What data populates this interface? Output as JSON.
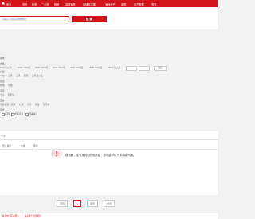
{
  "nav": {
    "logo": "房米",
    "items": [
      "首页",
      "新房",
      "二手房",
      "租房",
      "装修家居",
      "商铺写字楼",
      "海外房产",
      "家居",
      "房产数据",
      "登录"
    ]
  },
  "search": {
    "placeholder": "请输入小区名称或地址",
    "button_label": "搜 索"
  },
  "filters": {
    "region_label": "区域",
    "price_label": "价格",
    "price_options": [
      "1000元以下",
      "1000-1500元",
      "1500-2000元",
      "2000-3000元",
      "3000-4000元",
      "4000-5000元",
      "5000元以上"
    ],
    "confirm_label": "确定",
    "rooms_label": "户型",
    "rooms_options": [
      "一室",
      "二室",
      "三室",
      "四室",
      "五室及以上"
    ],
    "type_label": "类型",
    "type_options": [
      "整租",
      "合租"
    ],
    "source_label": "来源",
    "source_options": [
      "个人",
      "经纪人"
    ],
    "more_label": "更多",
    "more_options": [
      "普通住宅",
      "别墅",
      "公寓",
      "平房",
      "商住",
      "写字楼"
    ],
    "check_label": "筛选",
    "check_options": [
      "有图",
      "视频房源",
      "直播看房"
    ]
  },
  "results": {
    "tab": "个人",
    "sort": [
      "默认排序",
      "价格",
      "面积"
    ],
    "empty_message": "很抱歉，没有找到相符的房源，您可能对以下房源感兴趣。"
  },
  "pager": {
    "prev": "首页",
    "current": "1",
    "next": "尾页",
    "last": "末页"
  },
  "bottom_tabs": [
    "临安热门区域租房",
    "临安热门楼盘租房"
  ],
  "colors": {
    "brand": "#d3141c"
  }
}
